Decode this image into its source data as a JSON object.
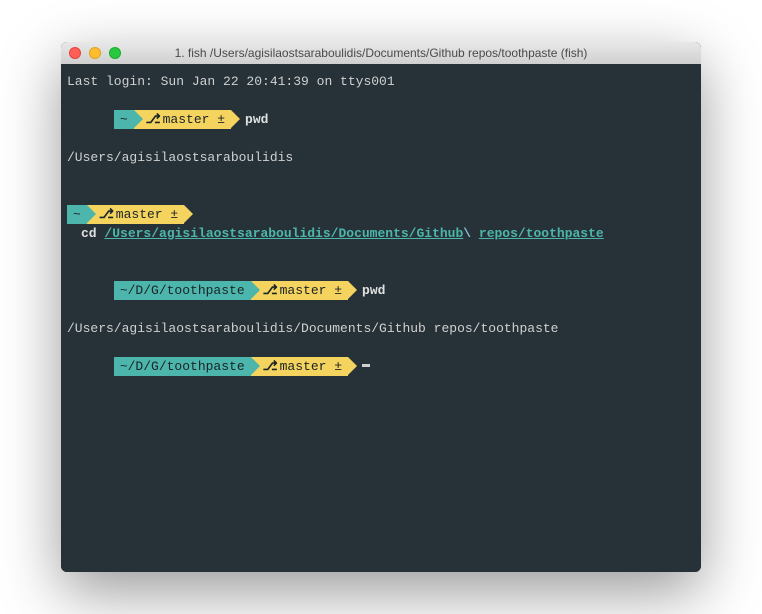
{
  "window": {
    "title": "1. fish  /Users/agisilaostsaraboulidis/Documents/Github repos/toothpaste (fish)"
  },
  "lines": {
    "login": "Last login: Sun Jan 22 20:41:39 on ttys001",
    "prompt1": {
      "dir": "~",
      "branch_icon": "⎇",
      "branch": "master ±",
      "cmd": "pwd"
    },
    "output1": "/Users/agisilaostsaraboulidis",
    "prompt2": {
      "dir": "~",
      "branch_icon": "⎇",
      "branch": "master ±",
      "cmd": "cd",
      "path_a": "/Users/agisilaostsaraboulidis/Documents/Github",
      "escape": "\\ ",
      "path_b": "repos/toothpaste"
    },
    "prompt3": {
      "dir": "~/D/G/toothpaste",
      "branch_icon": "⎇",
      "branch": "master ±",
      "cmd": "pwd"
    },
    "output3": "/Users/agisilaostsaraboulidis/Documents/Github repos/toothpaste",
    "prompt4": {
      "dir": "~/D/G/toothpaste",
      "branch_icon": "⎇",
      "branch": "master ±"
    }
  }
}
